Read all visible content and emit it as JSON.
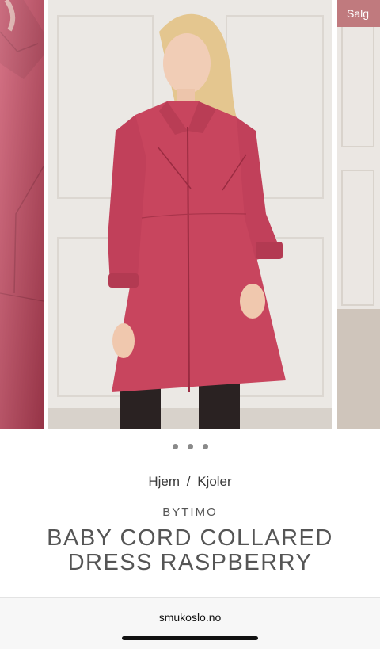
{
  "gallery": {
    "badge": "Salg",
    "dots": [
      1,
      2,
      3
    ],
    "active_dot": 1
  },
  "product": {
    "breadcrumb": [
      "Hjem",
      "Kjoler"
    ],
    "breadcrumb_separator": "/",
    "brand": "BYTIMO",
    "title": "BABY CORD COLLARED DRESS RASPBERRY"
  },
  "browser": {
    "url": "smukoslo.no"
  },
  "colors": {
    "dress": "#c8455e",
    "badge": "#c07a7e",
    "background_wall": "#ebe8e4"
  },
  "icons": {
    "zoom": "search-icon"
  }
}
